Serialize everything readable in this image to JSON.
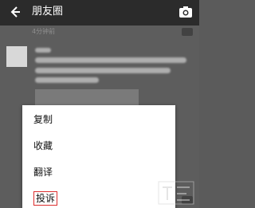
{
  "header": {
    "title": "朋友圈"
  },
  "post": {
    "time_ago": "4分钟前"
  },
  "context_menu": {
    "items": [
      {
        "label": "复制"
      },
      {
        "label": "收藏"
      },
      {
        "label": "翻译"
      },
      {
        "label": "投诉"
      }
    ]
  },
  "colors": {
    "header_bg": "#2b2b2b",
    "feed_dimmed_bg": "#5d5d5d",
    "menu_bg": "#ffffff",
    "highlight_border": "#dc2d2d"
  }
}
